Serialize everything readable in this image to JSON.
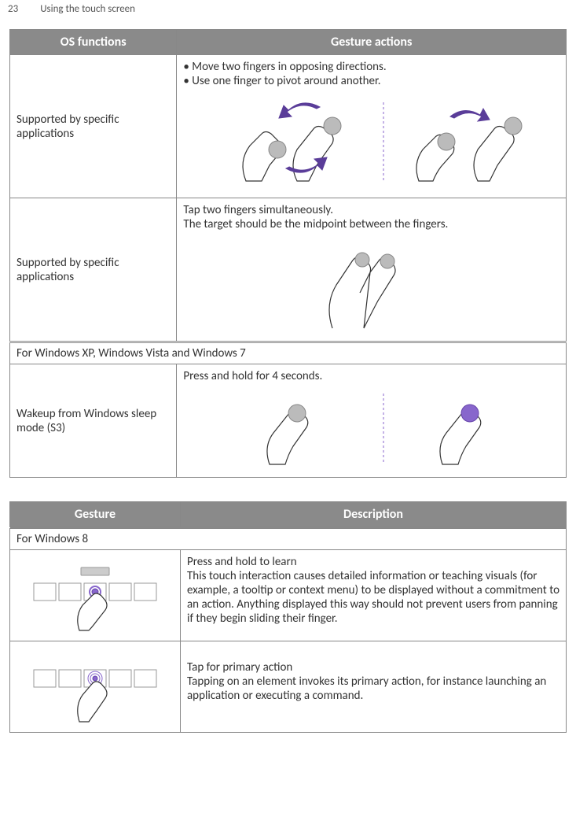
{
  "header": {
    "page_number": "23",
    "title": "Using the touch screen"
  },
  "table1": {
    "col1_header": "OS functions",
    "col2_header": "Gesture actions",
    "row1": {
      "left": "Supported by specific applications",
      "bullet1": "• Move two fingers in opposing directions.",
      "bullet2": "• Use one finger to pivot around another."
    },
    "row2": {
      "left": "Supported by specific applications",
      "line1": "Tap two fingers simultaneously.",
      "line2": "The target should be the midpoint between the fingers."
    },
    "section": "For Windows XP, Windows Vista and Windows 7",
    "row3": {
      "left": "Wakeup from Windows sleep mode (S3)",
      "line1": "Press and hold for 4 seconds."
    }
  },
  "table2": {
    "col1_header": "Gesture",
    "col2_header": "Description",
    "section": "For Windows 8",
    "row1": {
      "title": "Press and hold to learn",
      "body": "This touch interaction causes detailed information or teaching visuals (for example, a tooltip or context menu) to be displayed without a commitment to an action. Anything displayed this way should not prevent users from panning if they begin sliding their finger."
    },
    "row2": {
      "title": "Tap for primary action",
      "body": "Tapping on an element invokes its primary action, for instance launching an application or executing a command."
    }
  }
}
